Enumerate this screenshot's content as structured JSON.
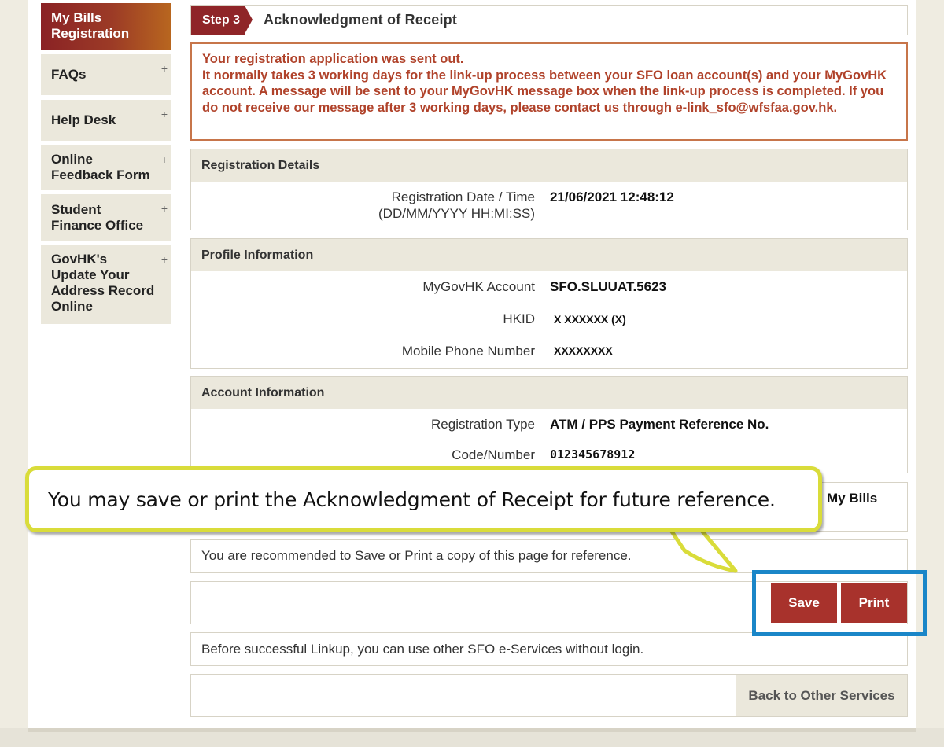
{
  "sidebar": {
    "items": [
      {
        "label": "My Bills Registration",
        "active": true
      },
      {
        "label": "FAQs"
      },
      {
        "label": "Help Desk"
      },
      {
        "label": "Online Feedback Form"
      },
      {
        "label": "Student Finance Office"
      },
      {
        "label": "GovHK's Update Your Address Record Online"
      }
    ],
    "expand_glyph": "+"
  },
  "step": {
    "tag": "Step 3",
    "title": "Acknowledgment of Receipt"
  },
  "notice": {
    "lines": [
      "Your registration application was sent out.",
      "It normally takes 3 working days for the link-up process between your SFO loan account(s) and your MyGovHK account. A message will be sent to your MyGovHK message box when the link-up process is completed. If you do not receive our message after 3 working days, please contact us through e-link_sfo@wfsfaa.gov.hk."
    ]
  },
  "registration_details": {
    "heading": "Registration Details",
    "date_label_1": "Registration Date / Time",
    "date_label_2": "(DD/MM/YYYY HH:MI:SS)",
    "date_value": "21/06/2021 12:48:12"
  },
  "profile": {
    "heading": "Profile Information",
    "account_label": "MyGovHK Account",
    "account_value": "SFO.SLUUAT.5623",
    "hkid_label": "HKID",
    "hkid_value": "X XXXXXX (X)",
    "phone_label": "Mobile Phone Number",
    "phone_value": "XXXXXXXX"
  },
  "account": {
    "heading": "Account Information",
    "type_label": "Registration Type",
    "type_value": "ATM / PPS Payment Reference No.",
    "code_label": "Code/Number",
    "code_value": "012345678912"
  },
  "partial_panel": {
    "value": "My Bills"
  },
  "recommend_text": "You are recommended to Save or Print a copy of this page for reference.",
  "buttons": {
    "save": "Save",
    "print": "Print"
  },
  "before_text": "Before successful Linkup, you can use other SFO e-Services without login.",
  "back_button": "Back to Other Services",
  "callout": "You may save or print the Acknowledgment of Receipt for future reference.",
  "colors": {
    "accent_maroon": "#8f2528",
    "button_red": "#a8322c",
    "notice_text": "#b0422a",
    "highlight_blue": "#1a86c8",
    "callout_border": "#d9dc3a"
  }
}
